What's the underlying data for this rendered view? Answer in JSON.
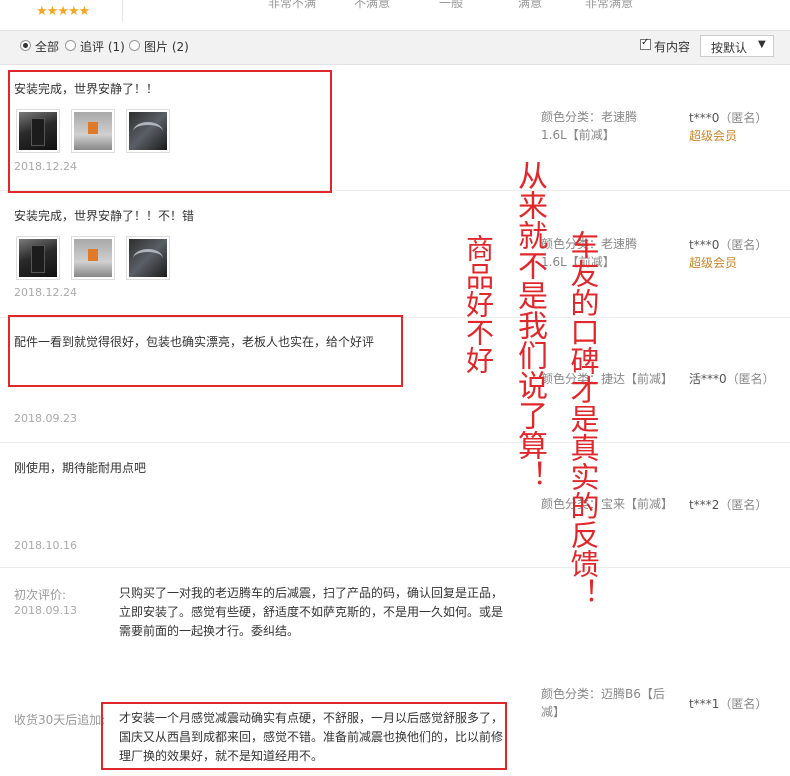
{
  "top_rating": {
    "stars": "★★★★★",
    "scale_labels": [
      "非常不满",
      "不满意",
      "一般",
      "满意",
      "非常满意"
    ]
  },
  "filter_bar": {
    "options": [
      {
        "label": "全部",
        "checked": true
      },
      {
        "label": "追评 (1)",
        "checked": false
      },
      {
        "label": "图片 (2)",
        "checked": false
      }
    ],
    "has_content_label": "有内容",
    "has_content_checked": true,
    "sort_label": "按默认",
    "sort_icon": "chevron-down-icon"
  },
  "reviews": [
    {
      "text": "安装完成，世界安静了！！",
      "date": "2018.12.24",
      "has_images": true,
      "meta_label": "颜色分类：",
      "meta_value_line1": "老速腾",
      "meta_value_line2": "1.6L【前减】",
      "user": "t***0",
      "anon": "（匿名）",
      "badge": "超级会员"
    },
    {
      "text": "安装完成，世界安静了！！不！错",
      "date": "2018.12.24",
      "has_images": true,
      "meta_label": "颜色分类：",
      "meta_value_line1": "老速腾",
      "meta_value_line2": "1.6L【前减】",
      "user": "t***0",
      "anon": "（匿名）",
      "badge": "超级会员"
    },
    {
      "text": "配件一看到就觉得很好，包装也确实漂亮，老板人也实在，给个好评",
      "date": "2018.09.23",
      "meta_label": "颜色分类：",
      "meta_value_line1": "捷达【前减】",
      "user": "活***0",
      "anon": "（匿名）"
    },
    {
      "text": "刚使用，期待能耐用点吧",
      "date": "2018.10.16",
      "meta_label": "颜色分类：",
      "meta_value_line1": "宝来【前减】",
      "user": "t***2",
      "anon": "（匿名）"
    },
    {
      "initial_label": "初次评价:",
      "date": "2018.09.13",
      "text": "只购买了一对我的老迈腾车的后减震，扫了产品的码，确认回复是正品，立即安装了。感觉有些硬，舒适度不如萨克斯的，不是用一久如何。或是需要前面的一起换才行。委纠结。",
      "followup_label": "收货30天后追加:",
      "followup_text": "才安装一个月感觉减震动确实有点硬，不舒服，一月以后感觉舒服多了，国庆又从西昌到成都来回，感觉不错。准备前减震也换他们的，比以前修理厂换的效果好，就不是知道经用不。",
      "meta_label": "颜色分类：",
      "meta_value_line1": "迈腾B6【后",
      "meta_value_line2": "减】",
      "user": "t***1",
      "anon": "（匿名）"
    }
  ],
  "overlays": {
    "left": "商品好不好",
    "middle": "从来就不是我们说了算！",
    "right": "车友的口碑才是真实的反馈！"
  }
}
